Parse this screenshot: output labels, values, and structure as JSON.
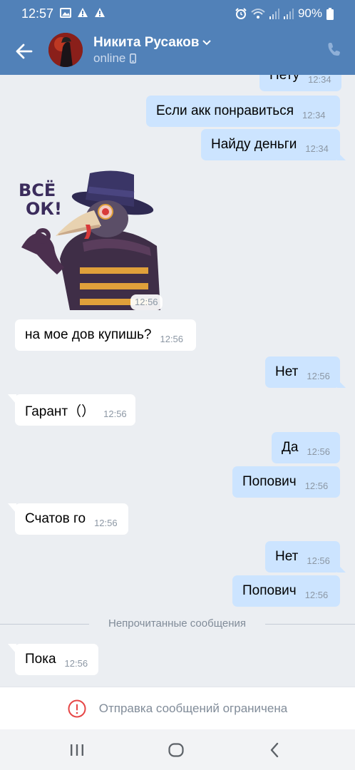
{
  "status_bar": {
    "time": "12:57",
    "battery": "90%",
    "icons": [
      "gallery-icon",
      "alert-icon",
      "alert-icon",
      "alarm-icon",
      "wifi-icon",
      "signal-icon",
      "signal-icon",
      "battery-icon"
    ]
  },
  "header": {
    "contact_name": "Никита Русаков",
    "status": "online",
    "background_color": "#5181b8"
  },
  "messages": [
    {
      "side": "out",
      "text": "Нету",
      "time": "12:34"
    },
    {
      "side": "out",
      "text": "Если акк понравиться",
      "time": "12:34"
    },
    {
      "side": "out",
      "text": "Найду деньги",
      "time": "12:34"
    },
    {
      "side": "in",
      "type": "sticker",
      "sticker_text": "ВСЁ ОК!",
      "time": "12:56"
    },
    {
      "side": "in",
      "text": "на мое дов купишь?",
      "time": "12:56"
    },
    {
      "side": "out",
      "text": "Нет",
      "time": "12:56"
    },
    {
      "side": "in",
      "text": "Гарант（）",
      "time": "12:56"
    },
    {
      "side": "out",
      "text": "Да",
      "time": "12:56"
    },
    {
      "side": "out",
      "text": "Попович",
      "time": "12:56"
    },
    {
      "side": "in",
      "text": "Счатов го",
      "time": "12:56"
    },
    {
      "side": "out",
      "text": "Нет",
      "time": "12:56"
    },
    {
      "side": "out",
      "text": "Попович",
      "time": "12:56"
    },
    {
      "side": "in",
      "text": "Пока",
      "time": "12:56"
    }
  ],
  "unread_divider": "Непрочитанные сообщения",
  "footer": {
    "message": "Отправка сообщений ограничена",
    "icon": "warning-circle-icon",
    "icon_color": "#e64646"
  },
  "colors": {
    "outgoing_bubble": "#cce4ff",
    "incoming_bubble": "#ffffff",
    "chat_background": "#ebeef2"
  }
}
